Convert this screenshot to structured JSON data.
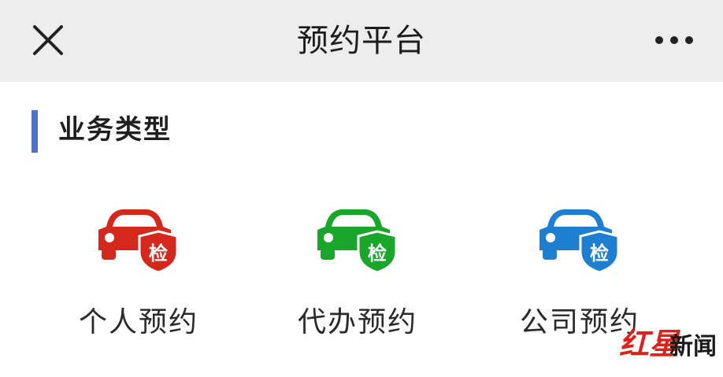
{
  "header": {
    "title": "预约平台",
    "close_icon": "close-icon",
    "more_icon": "more-dots-icon"
  },
  "section": {
    "title": "业务类型",
    "accent_color": "#4e72c9"
  },
  "services": [
    {
      "label": "个人预约",
      "badge": "检",
      "color": "#d3281b",
      "icon": "car-inspection-icon"
    },
    {
      "label": "代办预约",
      "badge": "检",
      "color": "#19a62a",
      "icon": "car-inspection-icon"
    },
    {
      "label": "公司预约",
      "badge": "检",
      "color": "#1e7fd0",
      "icon": "car-inspection-icon"
    }
  ],
  "watermark": {
    "text": "红星新闻",
    "part1": "红星",
    "part2": "新闻",
    "color_red": "#e0211a"
  }
}
